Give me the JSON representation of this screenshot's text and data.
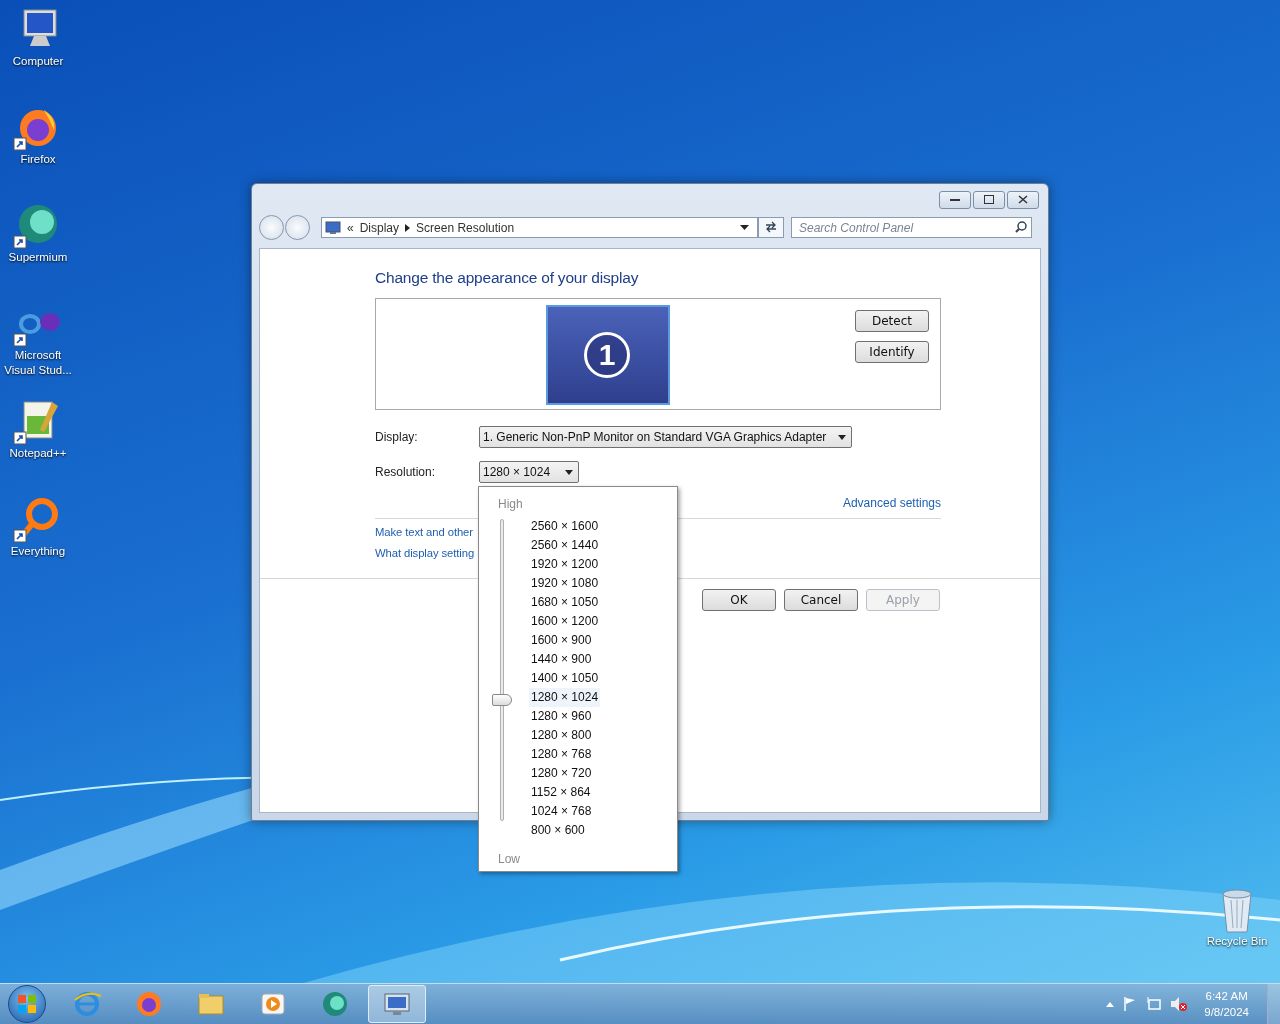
{
  "desktop_icons": [
    {
      "kind": "computer",
      "label": "Computer",
      "shortcut": false
    },
    {
      "kind": "firefox",
      "label": "Firefox",
      "shortcut": true
    },
    {
      "kind": "supermium",
      "label": "Supermium",
      "shortcut": true
    },
    {
      "kind": "studio",
      "label": "Microsoft Visual Stud...",
      "shortcut": true
    },
    {
      "kind": "notepad",
      "label": "Notepad++",
      "shortcut": true
    },
    {
      "kind": "everything",
      "label": "Everything",
      "shortcut": true
    }
  ],
  "recycle_bin": {
    "label": "Recycle Bin"
  },
  "window": {
    "breadcrumb_prefix": "«",
    "breadcrumb": [
      "Display",
      "Screen Resolution"
    ],
    "search": {
      "placeholder": "Search Control Panel"
    },
    "heading": "Change the appearance of your display",
    "monitor_number": "1",
    "side_buttons": [
      "Detect",
      "Identify"
    ],
    "display": {
      "label": "Display:",
      "value": "1. Generic Non-PnP Monitor on Standard VGA Graphics Adapter"
    },
    "resolution": {
      "label": "Resolution:",
      "value": "1280 × 1024"
    },
    "advanced_link": "Advanced settings",
    "links": [
      "Make text and other",
      "What display setting"
    ],
    "buttons": [
      {
        "label": "OK",
        "disabled": false
      },
      {
        "label": "Cancel",
        "disabled": false
      },
      {
        "label": "Apply",
        "disabled": true
      }
    ]
  },
  "resolution_menu": {
    "high": "High",
    "low": "Low",
    "options": [
      {
        "label": "2560 × 1600",
        "selected": false
      },
      {
        "label": "2560 × 1440",
        "selected": false
      },
      {
        "label": "1920 × 1200",
        "selected": false
      },
      {
        "label": "1920 × 1080",
        "selected": false
      },
      {
        "label": "1680 × 1050",
        "selected": false
      },
      {
        "label": "1600 × 1200",
        "selected": false
      },
      {
        "label": "1600 × 900",
        "selected": false
      },
      {
        "label": "1440 × 900",
        "selected": false
      },
      {
        "label": "1400 × 1050",
        "selected": false
      },
      {
        "label": "1280 × 1024",
        "selected": true
      },
      {
        "label": "1280 × 960",
        "selected": false
      },
      {
        "label": "1280 × 800",
        "selected": false
      },
      {
        "label": "1280 × 768",
        "selected": false
      },
      {
        "label": "1280 × 720",
        "selected": false
      },
      {
        "label": "1152 × 864",
        "selected": false
      },
      {
        "label": "1024 × 768",
        "selected": false
      },
      {
        "label": "800 × 600",
        "selected": false
      }
    ]
  },
  "taskbar": {
    "apps": [
      {
        "kind": "ie",
        "selected": false
      },
      {
        "kind": "firefox",
        "selected": false
      },
      {
        "kind": "folder",
        "selected": false
      },
      {
        "kind": "media",
        "selected": false
      },
      {
        "kind": "supermium",
        "selected": false
      },
      {
        "kind": "display",
        "selected": true
      }
    ],
    "clock": {
      "time": "6:42 AM",
      "date": "9/8/2024"
    }
  }
}
